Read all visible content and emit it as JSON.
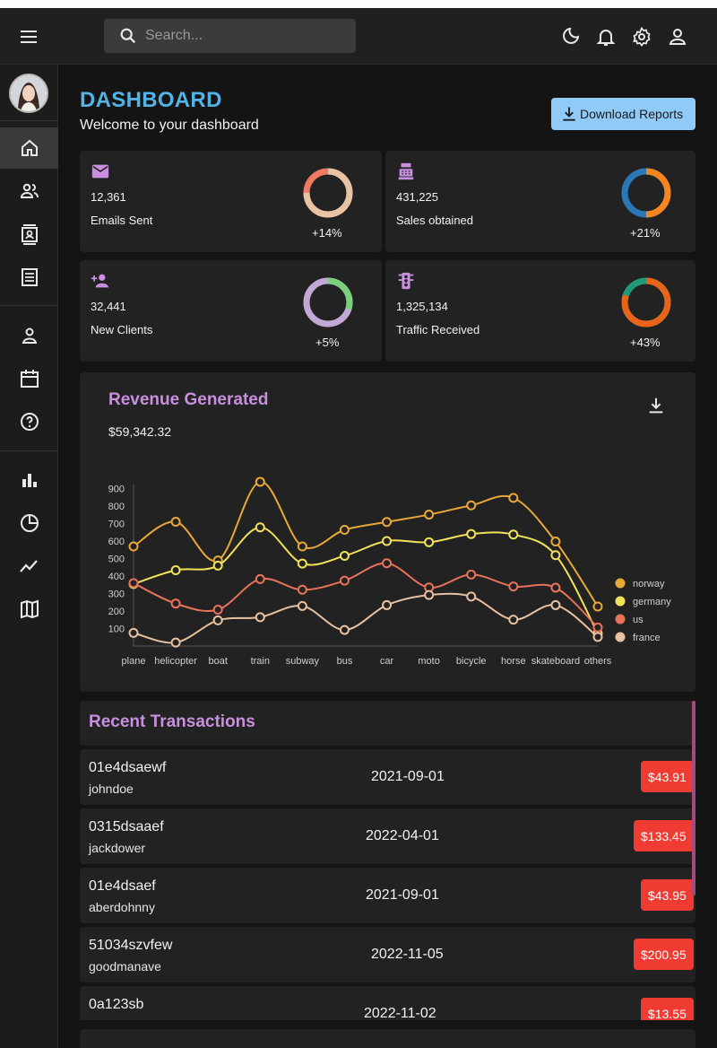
{
  "search": {
    "placeholder": "Search..."
  },
  "header": {
    "title": "DASHBOARD",
    "subtitle": "Welcome to your dashboard",
    "download_label": "Download Reports"
  },
  "stats": [
    {
      "value": "12,361",
      "label": "Emails Sent",
      "increase": "+14%",
      "progress": 0.75,
      "ring_colors": [
        "#e8c4a6",
        "#f07a63"
      ]
    },
    {
      "value": "431,225",
      "label": "Sales obtained",
      "increase": "+21%",
      "progress": 0.5,
      "ring_colors": [
        "#f7861f",
        "#2a78b7"
      ]
    },
    {
      "value": "32,441",
      "label": "New Clients",
      "increase": "+5%",
      "progress": 0.3,
      "ring_colors": [
        "#7bcf7d",
        "#c3a8d6"
      ]
    },
    {
      "value": "1,325,134",
      "label": "Traffic Received",
      "increase": "+43%",
      "progress": 0.8,
      "ring_colors": [
        "#e8641a",
        "#1f9b7a"
      ]
    }
  ],
  "revenue": {
    "title": "Revenue Generated",
    "amount": "$59,342.32"
  },
  "chart_data": {
    "type": "line",
    "categories": [
      "plane",
      "helicopter",
      "boat",
      "train",
      "subway",
      "bus",
      "car",
      "moto",
      "bicycle",
      "horse",
      "skateboard",
      "others"
    ],
    "yticks": [
      100,
      200,
      300,
      400,
      500,
      600,
      700,
      800,
      900
    ],
    "ylim": [
      0,
      950
    ],
    "legend_position": "right",
    "series": [
      {
        "name": "norway",
        "color": "#e8a838",
        "values": [
          570,
          711,
          490,
          940,
          570,
          665,
          710,
          752,
          805,
          848,
          598,
          226
        ]
      },
      {
        "name": "germany",
        "color": "#f1e15b",
        "values": [
          355,
          434,
          460,
          679,
          472,
          516,
          601,
          594,
          641,
          638,
          520,
          72
        ]
      },
      {
        "name": "us",
        "color": "#e8725a",
        "values": [
          360,
          243,
          208,
          383,
          322,
          374,
          474,
          335,
          409,
          341,
          334,
          106
        ]
      },
      {
        "name": "france",
        "color": "#e8c1a0",
        "values": [
          75,
          20,
          147,
          165,
          229,
          92,
          234,
          292,
          283,
          151,
          234,
          52
        ]
      }
    ]
  },
  "transactions": {
    "title": "Recent Transactions",
    "items": [
      {
        "id": "01e4dsaewf",
        "user": "johndoe",
        "date": "2021-09-01",
        "cost": "$43.91"
      },
      {
        "id": "0315dsaaef",
        "user": "jackdower",
        "date": "2022-04-01",
        "cost": "$133.45"
      },
      {
        "id": "01e4dsaef",
        "user": "aberdohnny",
        "date": "2021-09-01",
        "cost": "$43.95"
      },
      {
        "id": "51034szvfew",
        "user": "goodmanave",
        "date": "2022-11-05",
        "cost": "$200.95"
      },
      {
        "id": "0a123sb",
        "user": "",
        "date": "2022-11-02",
        "cost": "$13.55"
      }
    ]
  }
}
